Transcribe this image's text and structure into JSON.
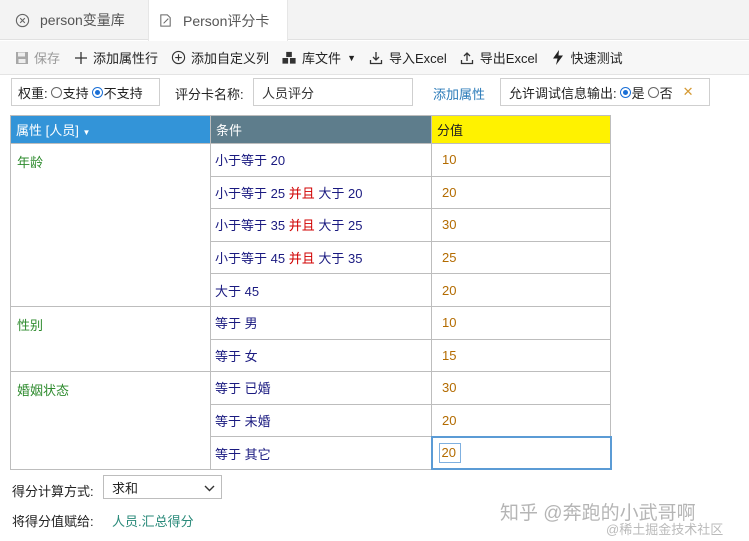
{
  "tabs": [
    {
      "label": "person变量库",
      "icon": "close-circle-icon"
    },
    {
      "label": "Person评分卡",
      "icon": "edit-document-icon"
    }
  ],
  "toolbar": {
    "save": "保存",
    "add_attr_row": "添加属性行",
    "add_custom_col": "添加自定义列",
    "lib_files": "库文件",
    "import_excel": "导入Excel",
    "export_excel": "导出Excel",
    "quick_test": "快速测试"
  },
  "options": {
    "weight_label": "权重:",
    "weight_support": "支持",
    "weight_not_support": "不支持",
    "weight_selected": "不支持",
    "card_name_label": "评分卡名称:",
    "card_name_value": "人员评分",
    "add_attribute": "添加属性",
    "debug_label": "允许调试信息输出:",
    "debug_yes": "是",
    "debug_no": "否",
    "debug_selected": "是"
  },
  "grid": {
    "headers": {
      "attribute": "属性 [人员]",
      "condition": "条件",
      "score": "分值"
    },
    "attributes": [
      {
        "name": "年龄",
        "rows": [
          {
            "cond": [
              [
                "小于等于",
                "20"
              ]
            ],
            "score": "10"
          },
          {
            "cond": [
              [
                "小于等于",
                "25"
              ],
              [
                "大于",
                "20"
              ]
            ],
            "score": "20"
          },
          {
            "cond": [
              [
                "小于等于",
                "35"
              ],
              [
                "大于",
                "25"
              ]
            ],
            "score": "30"
          },
          {
            "cond": [
              [
                "小于等于",
                "45"
              ],
              [
                "大于",
                "35"
              ]
            ],
            "score": "25"
          },
          {
            "cond": [
              [
                "大于",
                "45"
              ]
            ],
            "score": "20"
          }
        ]
      },
      {
        "name": "性别",
        "rows": [
          {
            "cond": [
              [
                "等于",
                "男"
              ]
            ],
            "score": "10"
          },
          {
            "cond": [
              [
                "等于",
                "女"
              ]
            ],
            "score": "15"
          }
        ]
      },
      {
        "name": "婚姻状态",
        "rows": [
          {
            "cond": [
              [
                "等于",
                "已婚"
              ]
            ],
            "score": "30"
          },
          {
            "cond": [
              [
                "等于",
                "未婚"
              ]
            ],
            "score": "20"
          },
          {
            "cond": [
              [
                "等于",
                "其它"
              ]
            ],
            "score": "20",
            "editing": true
          }
        ]
      }
    ],
    "and_word": "并且"
  },
  "footer": {
    "calc_label": "得分计算方式:",
    "calc_value": "求和",
    "assign_label": "将得分值赋给:",
    "assign_value": "人员.汇总得分"
  },
  "watermark": {
    "line1": "知乎 @奔跑的小武哥啊",
    "line2": "@稀土掘金技术社区"
  },
  "colors": {
    "attr_header": "#3394d8",
    "cond_header": "#5e7d8c",
    "score_header": "#fff200",
    "attr_text": "#2e8b2e",
    "and_text": "#d00000"
  }
}
